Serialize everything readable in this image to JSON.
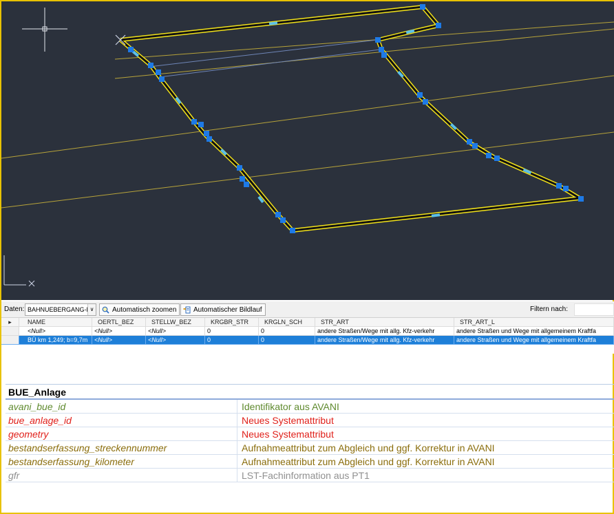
{
  "viewport": {
    "background": "#2b313c",
    "crosshair_icon": "crosshair-cursor-icon",
    "ucs_icon": "ucs-axis-icon",
    "polygon_color": "#f2e21a",
    "grip_color": "#1e7ae6",
    "guide_line_color": "#b8a43a",
    "highlight_line_color": "#6f86b8"
  },
  "toolbar": {
    "data_label": "Daten:",
    "data_value": "BAHNUEBERGANG-lin",
    "auto_zoom_label": "Automatisch zoomen",
    "auto_scroll_label": "Automatischer Bildlauf",
    "filter_label": "Filtern nach:"
  },
  "grid": {
    "headers": [
      "NAME",
      "OERTL_BEZ",
      "STELLW_BEZ",
      "KRGBR_STR",
      "KRGLN_SCH",
      "STR_ART",
      "STR_ART_L"
    ],
    "rows": [
      [
        "<Null>",
        "<Null>",
        "<Null>",
        "0",
        "0",
        "andere Straßen/Wege mit allg. Kfz-verkehr",
        "andere Straßen und Wege mit allgemeinem Kraftfa"
      ],
      [
        "BÜ km 1,249; b=9,7m",
        "<Null>",
        "<Null>",
        "0",
        "0",
        "andere Straßen/Wege mit allg. Kfz-verkehr",
        "andere Straßen und Wege mit allgemeinem Kraftfa"
      ]
    ],
    "selected_row": 1,
    "selection_color": "#1e7fd8"
  },
  "attributes": {
    "title": "BUE_Anlage",
    "rows": [
      {
        "key": "avani_bue_id",
        "value": "Identifikator aus AVANI",
        "color": "#5f8a2e"
      },
      {
        "key": "bue_anlage_id",
        "value": "Neues Systemattribut",
        "color": "#e0201a"
      },
      {
        "key": "geometry",
        "value": "Neues Systemattribut",
        "color": "#e0201a"
      },
      {
        "key": "bestandserfassung_streckennummer",
        "value": "Aufnahmeattribut zum Abgleich und ggf. Korrektur in AVANI",
        "color": "#8a6d0c"
      },
      {
        "key": "bestandserfassung_kilometer",
        "value": "Aufnahmeattribut zum Abgleich und ggf. Korrektur in AVANI",
        "color": "#8a6d0c"
      },
      {
        "key": "gfr",
        "value": "LST-Fachinformation aus PT1",
        "color": "#909090"
      }
    ]
  }
}
